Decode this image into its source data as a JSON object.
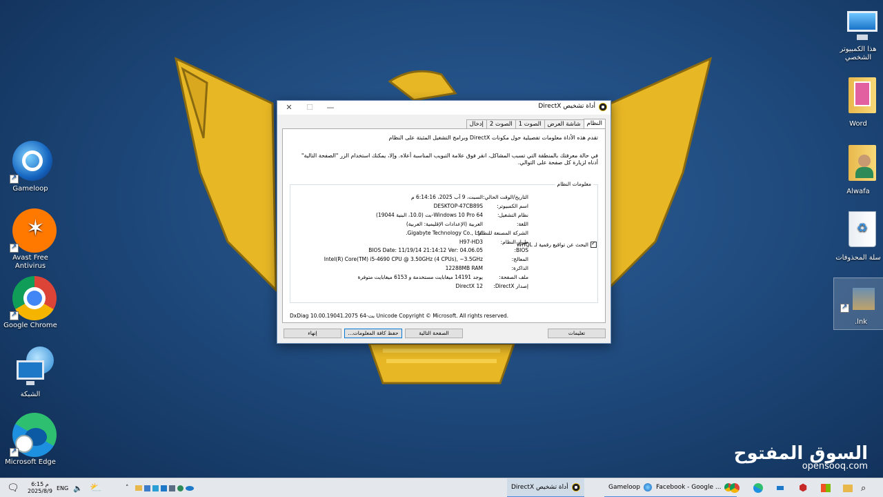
{
  "desktop": {
    "left_icons": [
      {
        "label": "Gameloop"
      },
      {
        "label": "Avast Free Antivirus"
      },
      {
        "label": "Google Chrome"
      },
      {
        "label": "الشبكة"
      },
      {
        "label": "Microsoft Edge"
      }
    ],
    "right_icons": [
      {
        "label": "هذا الكمبيوتر الشخصي"
      },
      {
        "label": "Word"
      },
      {
        "label": "Alwafa"
      },
      {
        "label": "سلة المحذوفات"
      },
      {
        "label": ".lnk"
      }
    ]
  },
  "window": {
    "title": "أداة تشخيص DirectX",
    "tabs": [
      "النظام",
      "شاشة العرض",
      "الصوت 1",
      "الصوت 2",
      "إدخال"
    ],
    "intro1": "تقدم هذه الأداة معلومات تفصيلية حول مكونات DirectX وبرامج التشغيل المثبتة على النظام",
    "intro2": "في حالة معرفتك بالمنطقة التي تسبب المشاكل، انقر فوق علامة التبويب المناسبة أعلاه. وإلا، يمكنك استخدام الزر \"الصفحة التالية\" أدناه لزيارة كل صفحة على التوالي.",
    "group_title": "معلومات النظام",
    "info": [
      {
        "key": "التاريخ/الوقت الحالي:",
        "value": "السبت، 9 آب 2025، 6:14:16 م"
      },
      {
        "key": "اسم الكمبيوتر:",
        "value": "DESKTOP-47CB89S"
      },
      {
        "key": "نظام التشغيل:",
        "value": "Windows 10 Pro 64-بت (10.0، البنية 19044)"
      },
      {
        "key": "اللغة:",
        "value": "العربية (الإعدادات الإقليمية: العربية)"
      },
      {
        "key": "الشركة المصنعة للنظام:",
        "value": "Gigabyte Technology Co., Ltd."
      },
      {
        "key": "طراز النظام:",
        "value": "H97-HD3"
      },
      {
        "key": "BIOS:",
        "value": "BIOS Date: 11/19/14 21:14:12 Ver: 04.06.05"
      },
      {
        "key": "المعالج:",
        "value": "Intel(R) Core(TM) i5-4690 CPU @ 3.50GHz (4 CPUs), ~3.5GHz"
      },
      {
        "key": "الذاكرة:",
        "value": "12288MB RAM"
      },
      {
        "key": "ملف الصفحة:",
        "value": "يوجد 14191 ميغابايت مستخدمة و 6153 ميغابايت متوفرة"
      },
      {
        "key": "إصدار DirectX:",
        "value": "DirectX 12"
      }
    ],
    "whql_label": "البحث عن تواقيع رقمية لـ WHQL",
    "copyright": "DxDiag 10.00.19041.2075 64-بت Unicode  Copyright © Microsoft. All rights reserved.",
    "buttons": {
      "help": "تعليمات",
      "next": "الصفحة التالية",
      "save": "حفظ كافة المعلومات...",
      "exit": "إنهاء"
    }
  },
  "taskbar": {
    "lang": "ENG",
    "time": "6:15 م",
    "date": "2025/8/9",
    "apps": [
      {
        "label": "أداة تشخيص DirectX"
      },
      {
        "label": "Gameloop"
      },
      {
        "label": "Facebook - Google ..."
      }
    ]
  },
  "watermark": {
    "arabic": "السوق المفتوح",
    "english": "opensooq.com"
  },
  "colors": {
    "emblem_gold": "#e8b725",
    "accent": "#0078d7"
  }
}
